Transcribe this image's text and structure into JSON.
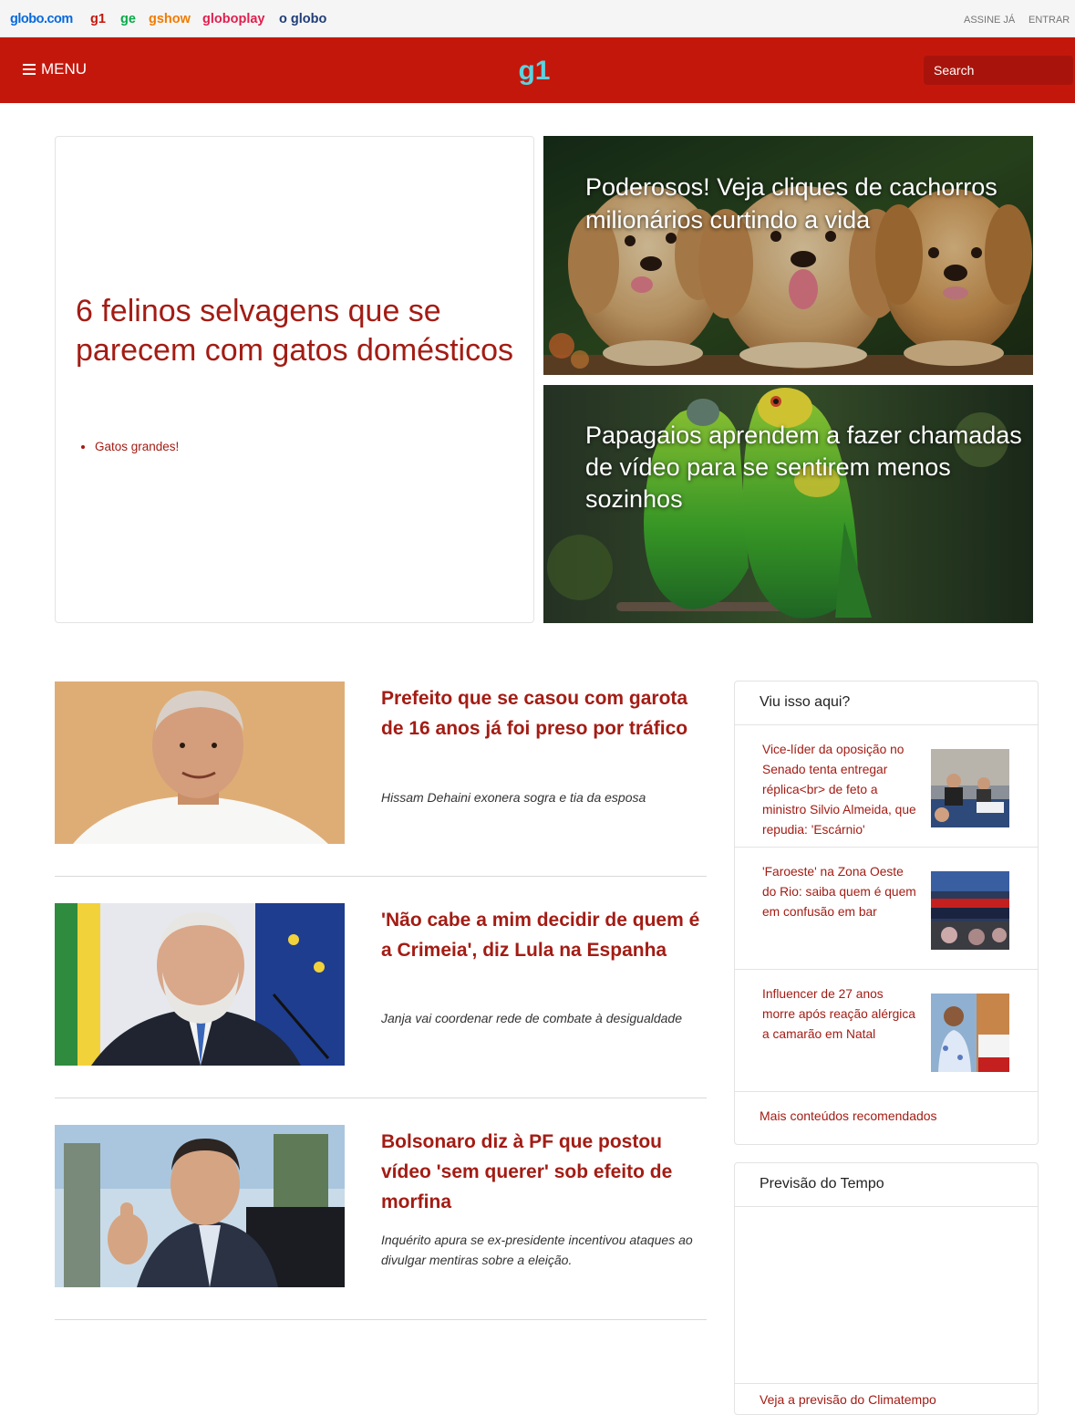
{
  "globo_bar": {
    "brands": [
      "globo.com",
      "g1",
      "ge",
      "gshow",
      "globoplay",
      "o globo"
    ],
    "assine": "ASSINE JÁ",
    "entrar": "ENTRAR"
  },
  "header": {
    "menu_label": "MENU",
    "logo_text": "g1",
    "search_placeholder": "Search"
  },
  "colors": {
    "header_red": "#c4170c",
    "headline_red": "#a31c14",
    "logo_teal": "#5ad3e0"
  },
  "hero": {
    "title": "6 felinos selvagens que se parecem com gatos domésticos",
    "bullets": [
      "Gatos grandes!"
    ],
    "photo_stories": [
      {
        "title": "Poderosos! Veja cliques de cachorros milionários curtindo a vida",
        "image": "golden-retriever-puppies"
      },
      {
        "title": "Papagaios aprendem a fazer chamadas de vídeo para se sentirem menos sozinhos",
        "image": "green-parrots"
      }
    ]
  },
  "feed": [
    {
      "title": "Prefeito que se casou com garota de 16 anos já foi preso por tráfico",
      "subtitle": "Hissam Dehaini exonera sogra e tia da esposa",
      "image": "bald-man-portrait"
    },
    {
      "title": "'Não cabe a mim decidir de quem é a Crimeia', diz Lula na Espanha",
      "subtitle": "Janja vai coordenar rede de combate à desigualdade",
      "image": "lula-portrait"
    },
    {
      "title": "Bolsonaro diz à PF que postou vídeo 'sem querer' sob efeito de morfina",
      "subtitle": "Inquérito apura se ex-presidente incentivou ataques ao divulgar mentiras sobre a eleição.",
      "image": "bolsonaro-thumbs-up"
    }
  ],
  "sidebar": {
    "recommended": {
      "title": "Viu isso aqui?",
      "items": [
        {
          "text": "Vice-líder da oposição no Senado tenta entregar réplica<br> de feto a ministro Silvio Almeida, que repudia: 'Escárnio'",
          "image": "senate-hearing"
        },
        {
          "text": "'Faroeste' na Zona Oeste do Rio: saiba quem é quem em confusão em bar",
          "image": "tv-news-bangue"
        },
        {
          "text": "Influencer de 27 anos morre após reação alérgica a camarão em Natal",
          "image": "influencer-photos"
        }
      ],
      "more": "Mais conteúdos recomendados"
    },
    "weather": {
      "title": "Previsão do Tempo",
      "more": "Veja a previsão do Climatempo"
    }
  }
}
